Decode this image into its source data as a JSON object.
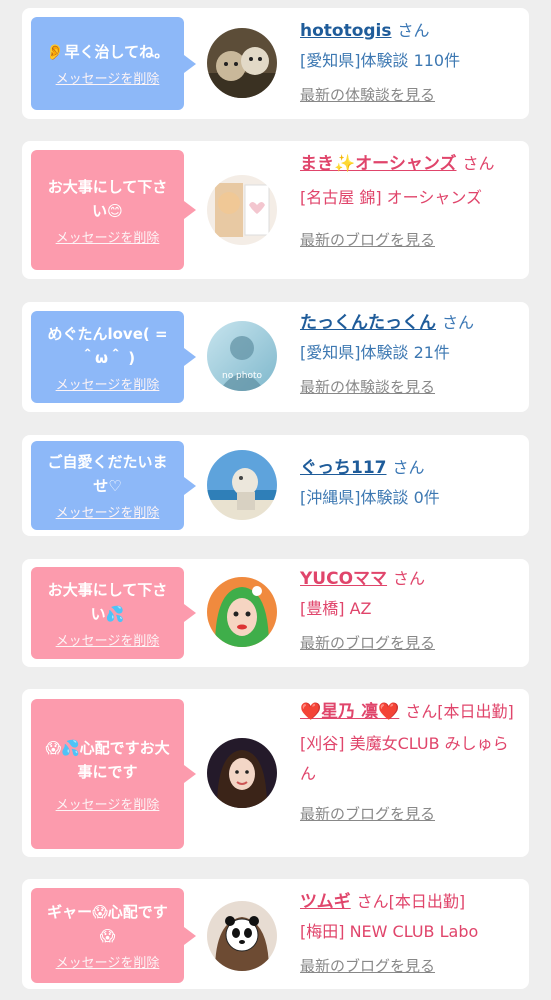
{
  "delete_label": "メッセージを削除",
  "colors": {
    "blue_bubble": "#8db8f8",
    "pink_bubble": "#fc9bad",
    "blue_text": "#1f5c9a",
    "pink_text": "#e0456b"
  },
  "cards": [
    {
      "message": "👂早く治してね。",
      "name": "hototogis",
      "suffix": "さん",
      "detail": "[愛知県]体験談 110件",
      "link": "最新の体験談を見る"
    },
    {
      "message": "お大事にして下さい😊",
      "name": "まき✨オーシャンズ",
      "suffix": "さん",
      "detail": "[名古屋 錦] オーシャンズ",
      "link": "最新のブログを見る"
    },
    {
      "message": "めぐたんlove( = ＾ω＾ )",
      "name": "たっくんたっくん",
      "suffix": "さん",
      "detail": "[愛知県]体験談 21件",
      "link": "最新の体験談を見る",
      "avatar_text": "no photo"
    },
    {
      "message": "ご自愛くだたいませ♡",
      "name": "ぐっち117",
      "suffix": "さん",
      "detail": "[沖縄県]体験談 0件",
      "link": ""
    },
    {
      "message": "お大事にして下さい💦",
      "name": "YUCOママ",
      "suffix": "さん",
      "detail": "[豊橋] AZ",
      "link": "最新のブログを見る"
    },
    {
      "message": "😱💦心配ですお大事にです",
      "name": "❤️星乃 凛❤️",
      "suffix": "さん[本日出勤]",
      "detail": "[刈谷] 美魔女CLUB みしゅらん",
      "link": "最新のブログを見る"
    },
    {
      "message": "ギャー😱心配です😱",
      "name": "ツムギ",
      "suffix": "さん[本日出勤]",
      "detail": "[梅田] NEW CLUB Labo",
      "link": "最新のブログを見る"
    }
  ]
}
